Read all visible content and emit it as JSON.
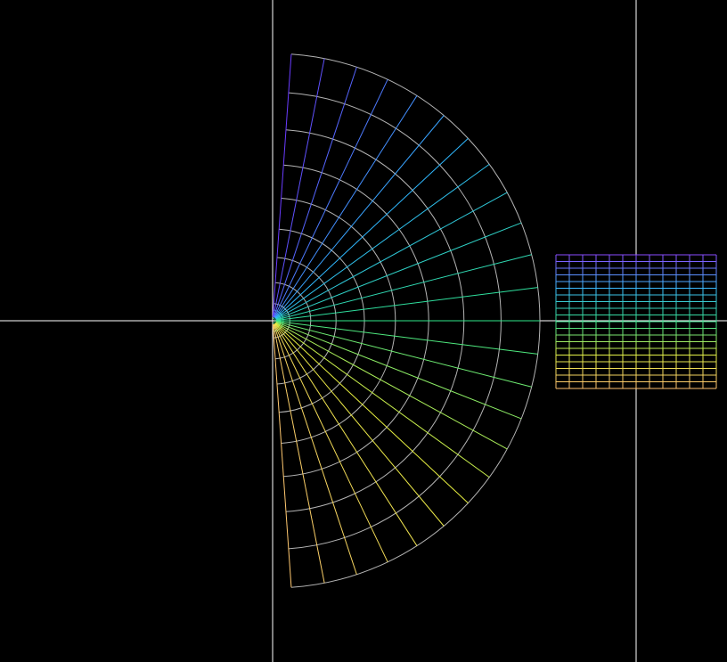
{
  "canvas": {
    "background": "#000000",
    "axis_color": "#ffffff",
    "circle_color": "#b4b4b4"
  },
  "polar_grid": {
    "angle_start_deg": -86,
    "angle_end_deg": 86,
    "radial_line_count": 24,
    "circle_count": 9,
    "color_start": "#6a3cff",
    "color_mid_1": "#2fb8ff",
    "color_mid_2": "#2fe88a",
    "color_mid_3": "#e8f040",
    "color_end": "#ffc870"
  },
  "rect_grid": {
    "columns": 12,
    "rows": 20,
    "color_top": "#8a4cff",
    "color_upper": "#3cbcff",
    "color_mid": "#36e08c",
    "color_lower": "#e4f048",
    "color_bottom": "#ffc070"
  }
}
